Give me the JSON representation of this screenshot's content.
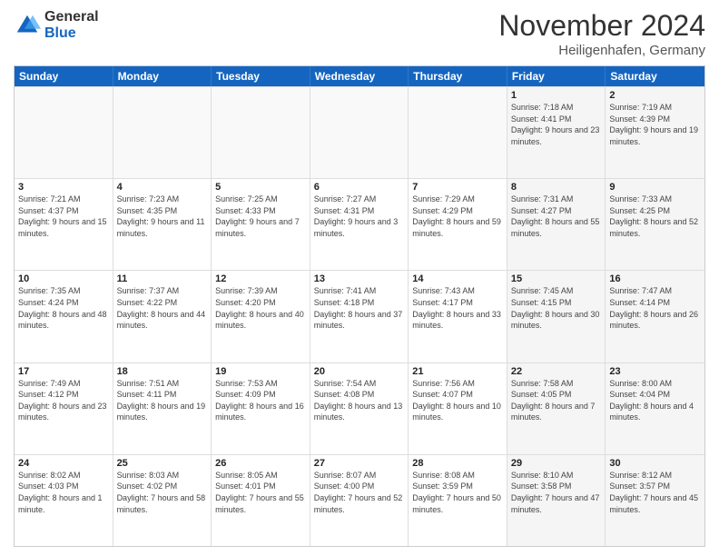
{
  "header": {
    "logo_general": "General",
    "logo_blue": "Blue",
    "month_title": "November 2024",
    "location": "Heiligenhafen, Germany"
  },
  "calendar": {
    "weekdays": [
      "Sunday",
      "Monday",
      "Tuesday",
      "Wednesday",
      "Thursday",
      "Friday",
      "Saturday"
    ],
    "rows": [
      [
        {
          "day": "",
          "empty": true
        },
        {
          "day": "",
          "empty": true
        },
        {
          "day": "",
          "empty": true
        },
        {
          "day": "",
          "empty": true
        },
        {
          "day": "",
          "empty": true
        },
        {
          "day": "1",
          "shaded": true,
          "sunrise": "7:18 AM",
          "sunset": "4:41 PM",
          "daylight": "9 hours and 23 minutes."
        },
        {
          "day": "2",
          "shaded": true,
          "sunrise": "7:19 AM",
          "sunset": "4:39 PM",
          "daylight": "9 hours and 19 minutes."
        }
      ],
      [
        {
          "day": "3",
          "sunrise": "7:21 AM",
          "sunset": "4:37 PM",
          "daylight": "9 hours and 15 minutes."
        },
        {
          "day": "4",
          "sunrise": "7:23 AM",
          "sunset": "4:35 PM",
          "daylight": "9 hours and 11 minutes."
        },
        {
          "day": "5",
          "sunrise": "7:25 AM",
          "sunset": "4:33 PM",
          "daylight": "9 hours and 7 minutes."
        },
        {
          "day": "6",
          "sunrise": "7:27 AM",
          "sunset": "4:31 PM",
          "daylight": "9 hours and 3 minutes."
        },
        {
          "day": "7",
          "sunrise": "7:29 AM",
          "sunset": "4:29 PM",
          "daylight": "8 hours and 59 minutes."
        },
        {
          "day": "8",
          "shaded": true,
          "sunrise": "7:31 AM",
          "sunset": "4:27 PM",
          "daylight": "8 hours and 55 minutes."
        },
        {
          "day": "9",
          "shaded": true,
          "sunrise": "7:33 AM",
          "sunset": "4:25 PM",
          "daylight": "8 hours and 52 minutes."
        }
      ],
      [
        {
          "day": "10",
          "sunrise": "7:35 AM",
          "sunset": "4:24 PM",
          "daylight": "8 hours and 48 minutes."
        },
        {
          "day": "11",
          "sunrise": "7:37 AM",
          "sunset": "4:22 PM",
          "daylight": "8 hours and 44 minutes."
        },
        {
          "day": "12",
          "sunrise": "7:39 AM",
          "sunset": "4:20 PM",
          "daylight": "8 hours and 40 minutes."
        },
        {
          "day": "13",
          "sunrise": "7:41 AM",
          "sunset": "4:18 PM",
          "daylight": "8 hours and 37 minutes."
        },
        {
          "day": "14",
          "sunrise": "7:43 AM",
          "sunset": "4:17 PM",
          "daylight": "8 hours and 33 minutes."
        },
        {
          "day": "15",
          "shaded": true,
          "sunrise": "7:45 AM",
          "sunset": "4:15 PM",
          "daylight": "8 hours and 30 minutes."
        },
        {
          "day": "16",
          "shaded": true,
          "sunrise": "7:47 AM",
          "sunset": "4:14 PM",
          "daylight": "8 hours and 26 minutes."
        }
      ],
      [
        {
          "day": "17",
          "sunrise": "7:49 AM",
          "sunset": "4:12 PM",
          "daylight": "8 hours and 23 minutes."
        },
        {
          "day": "18",
          "sunrise": "7:51 AM",
          "sunset": "4:11 PM",
          "daylight": "8 hours and 19 minutes."
        },
        {
          "day": "19",
          "sunrise": "7:53 AM",
          "sunset": "4:09 PM",
          "daylight": "8 hours and 16 minutes."
        },
        {
          "day": "20",
          "sunrise": "7:54 AM",
          "sunset": "4:08 PM",
          "daylight": "8 hours and 13 minutes."
        },
        {
          "day": "21",
          "sunrise": "7:56 AM",
          "sunset": "4:07 PM",
          "daylight": "8 hours and 10 minutes."
        },
        {
          "day": "22",
          "shaded": true,
          "sunrise": "7:58 AM",
          "sunset": "4:05 PM",
          "daylight": "8 hours and 7 minutes."
        },
        {
          "day": "23",
          "shaded": true,
          "sunrise": "8:00 AM",
          "sunset": "4:04 PM",
          "daylight": "8 hours and 4 minutes."
        }
      ],
      [
        {
          "day": "24",
          "sunrise": "8:02 AM",
          "sunset": "4:03 PM",
          "daylight": "8 hours and 1 minute."
        },
        {
          "day": "25",
          "sunrise": "8:03 AM",
          "sunset": "4:02 PM",
          "daylight": "7 hours and 58 minutes."
        },
        {
          "day": "26",
          "sunrise": "8:05 AM",
          "sunset": "4:01 PM",
          "daylight": "7 hours and 55 minutes."
        },
        {
          "day": "27",
          "sunrise": "8:07 AM",
          "sunset": "4:00 PM",
          "daylight": "7 hours and 52 minutes."
        },
        {
          "day": "28",
          "sunrise": "8:08 AM",
          "sunset": "3:59 PM",
          "daylight": "7 hours and 50 minutes."
        },
        {
          "day": "29",
          "shaded": true,
          "sunrise": "8:10 AM",
          "sunset": "3:58 PM",
          "daylight": "7 hours and 47 minutes."
        },
        {
          "day": "30",
          "shaded": true,
          "sunrise": "8:12 AM",
          "sunset": "3:57 PM",
          "daylight": "7 hours and 45 minutes."
        }
      ]
    ]
  }
}
